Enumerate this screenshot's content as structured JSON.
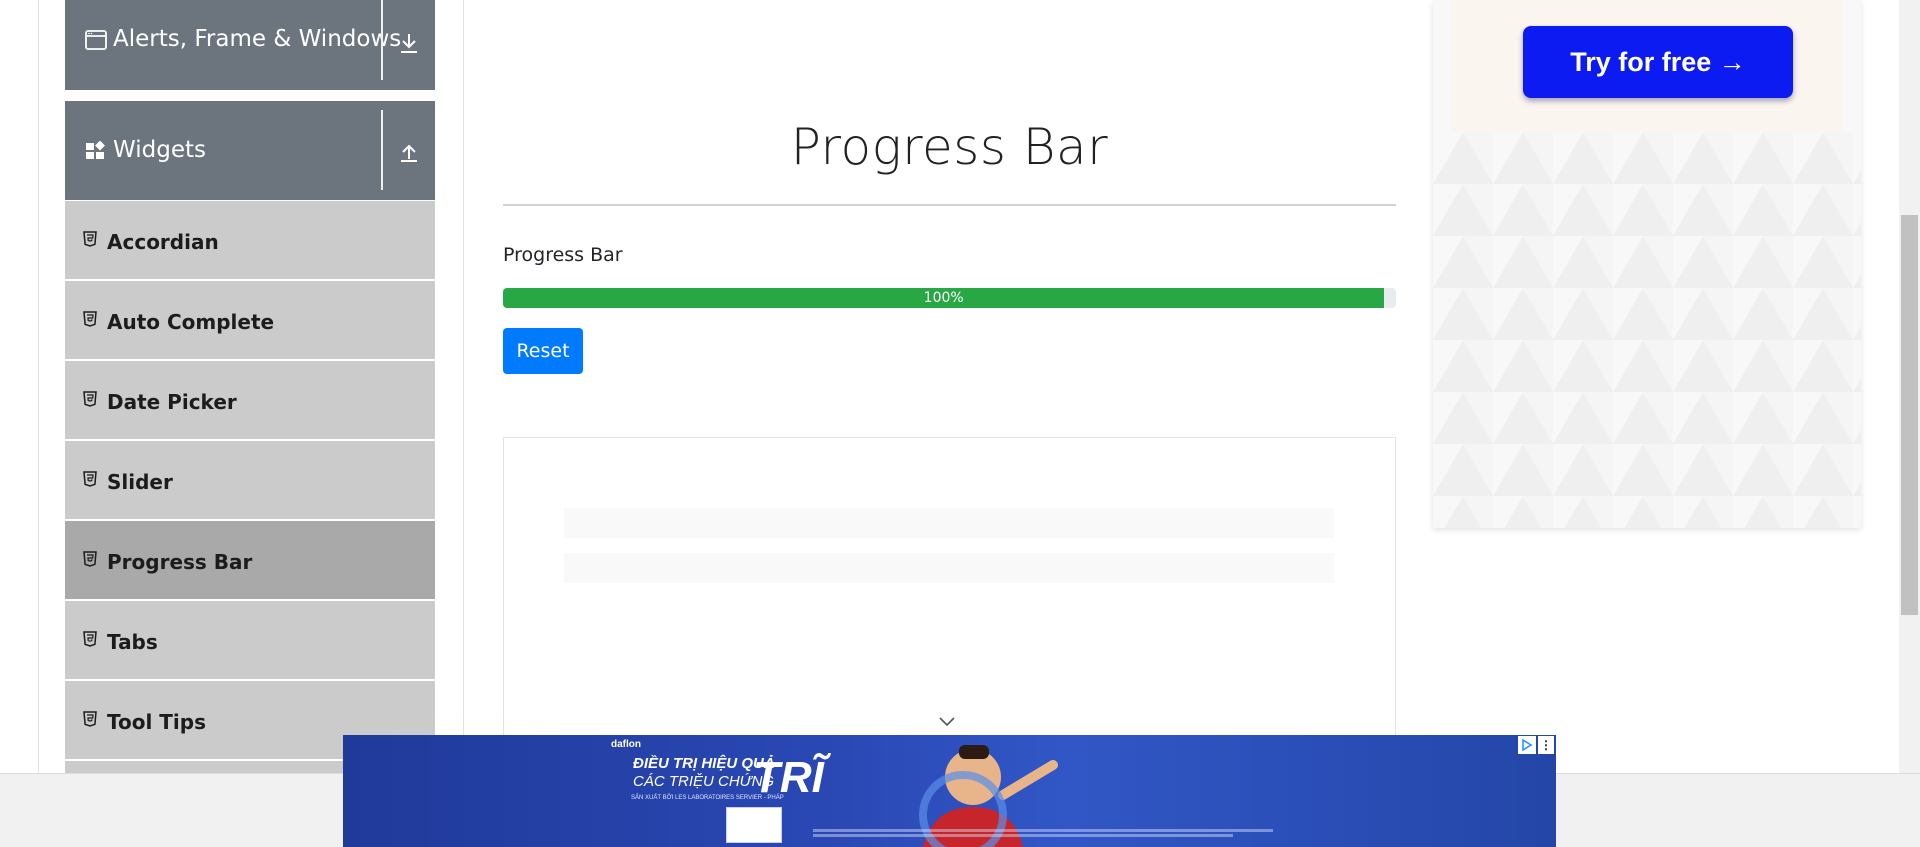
{
  "sidebar": {
    "groups": [
      {
        "label": "Alerts, Frame & Windows",
        "icon": "window-icon",
        "toggle_icon": "arrow-down-icon"
      },
      {
        "label": "Widgets",
        "icon": "widgets-icon",
        "toggle_icon": "arrow-up-icon"
      }
    ],
    "items": [
      {
        "label": "Accordian",
        "active": false
      },
      {
        "label": "Auto Complete",
        "active": false
      },
      {
        "label": "Date Picker",
        "active": false
      },
      {
        "label": "Slider",
        "active": false
      },
      {
        "label": "Progress Bar",
        "active": true
      },
      {
        "label": "Tabs",
        "active": false
      },
      {
        "label": "Tool Tips",
        "active": false
      }
    ],
    "item_icon": "html5-icon"
  },
  "main": {
    "title": "Progress Bar",
    "progress_label": "Progress Bar",
    "progress_value": 100,
    "progress_text": "100%",
    "reset_label": "Reset"
  },
  "right_ad": {
    "cta": "Try for free →"
  },
  "bottom_ad": {
    "brand": "daflon",
    "line1": "ĐIỀU TRỊ HIỆU QUẢ",
    "line2": "CÁC TRIỆU CHỨNG",
    "big": "TRĨ",
    "small": "SẢN XUẤT BỞI LES LABORATOIRES SERVIER - PHÁP",
    "menu_glyph": "⋮"
  },
  "colors": {
    "sidebar_group": "#6c757d",
    "menu_item": "#cbcbcb",
    "menu_item_active": "#a9a9a9",
    "progress_fill": "#28a745",
    "button_primary": "#007bff",
    "cta_button": "#0b1bf2"
  }
}
